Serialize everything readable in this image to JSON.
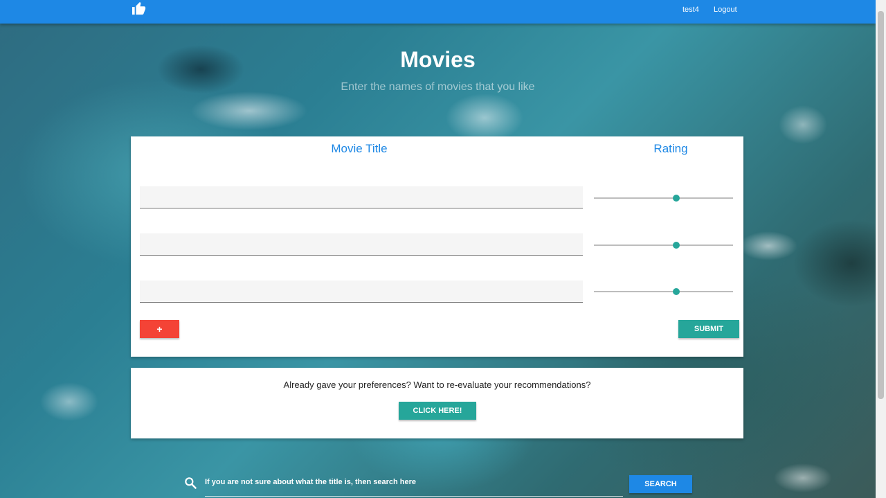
{
  "header": {
    "username": "test4",
    "logout_label": "Logout",
    "logo_icon": "thumbs-up-icon",
    "bar_color": "#1e88e5"
  },
  "hero": {
    "title": "Movies",
    "subtitle": "Enter the names of movies that you like"
  },
  "form": {
    "col_title_label": "Movie Title",
    "col_rating_label": "Rating",
    "rows": [
      {
        "title_value": "",
        "rating_fraction": 0.59
      },
      {
        "title_value": "",
        "rating_fraction": 0.59
      },
      {
        "title_value": "",
        "rating_fraction": 0.59
      }
    ],
    "add_label": "+",
    "submit_label": "SUBMIT",
    "add_color": "#f44336",
    "submit_color": "#26a69a"
  },
  "reeval": {
    "question": "Already gave your preferences? Want to re-evaluate your recommendations?",
    "button_label": "CLICK HERE!"
  },
  "search": {
    "icon": "search-icon",
    "placeholder": "If you are not sure about what the title is, then search here",
    "button_label": "SEARCH",
    "button_color": "#1e88e5"
  }
}
